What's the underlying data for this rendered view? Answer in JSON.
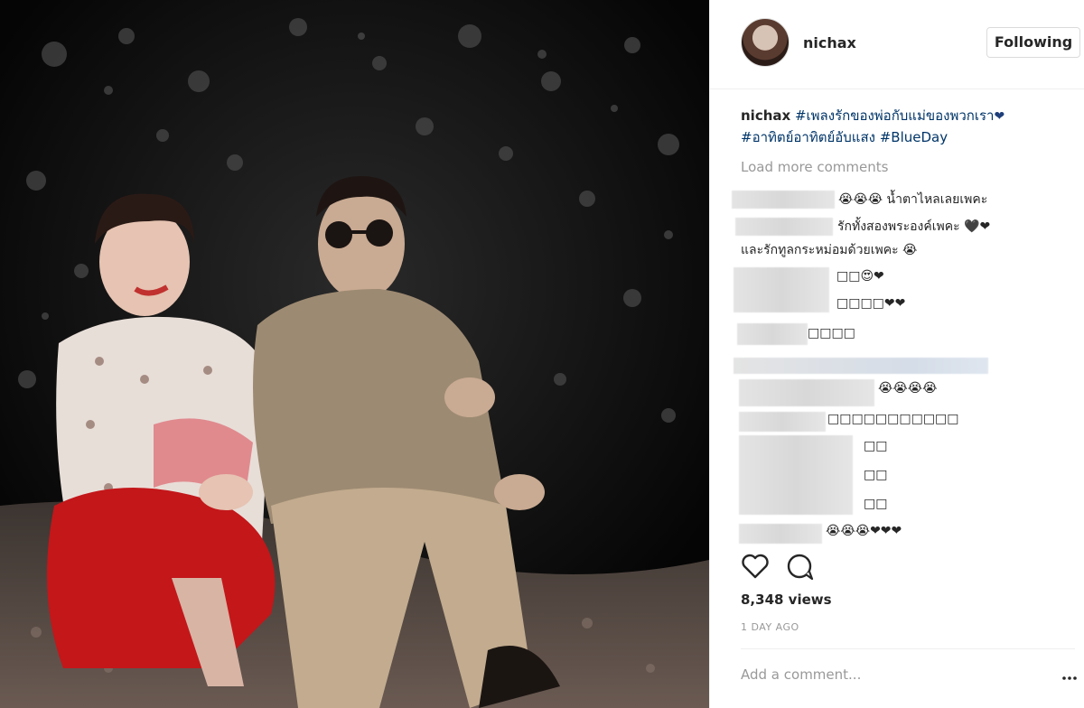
{
  "post": {
    "username": "nichax",
    "follow_label": "Following",
    "caption_user": "nichax",
    "caption_line1": " #เพลงรักของพ่อกับแม่ของพวกเรา",
    "caption_heart": "❤",
    "caption_line2": "#อาทิตย์อาทิตย์อับแสง #BlueDay",
    "load_more": "Load more comments",
    "views": "8,348 views",
    "time_ago": "1 DAY AGO",
    "add_comment_placeholder": "Add a comment..."
  },
  "comments": [
    {
      "text": "😭😭😭 น้ำตาไหลเลยเพคะ"
    },
    {
      "text": "รักทั้งสองพระองค์เพคะ 🖤❤"
    },
    {
      "text": "และรักทูลกระหม่อมด้วยเพคะ 😭"
    },
    {
      "text": "□□😍❤"
    },
    {
      "text": "□□□□❤❤"
    },
    {
      "text": "□□□□"
    },
    {
      "text": "😭😭😭😭"
    },
    {
      "text": "□□□□□□□□□□□"
    },
    {
      "text": "□□"
    },
    {
      "text": "□□"
    },
    {
      "text": "□□"
    },
    {
      "text": "😭😭😭❤❤❤"
    }
  ],
  "icons": {
    "like": "heart-icon",
    "comment": "comment-icon",
    "more": "more-options-icon"
  }
}
